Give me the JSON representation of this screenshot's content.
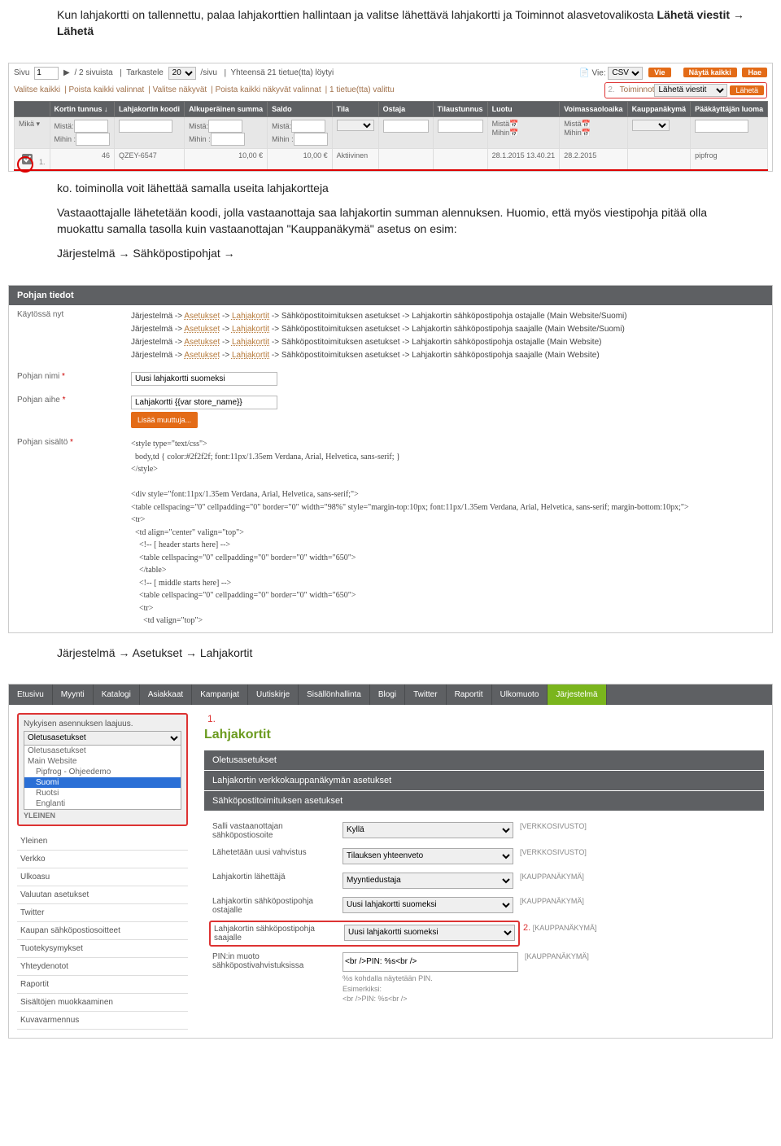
{
  "intro": {
    "p1a": "Kun lahjakortti on tallennettu, palaa lahjakorttien hallintaan ja valitse lähettävä lahjakortti ja Toiminnot alasvetovalikosta ",
    "p1b": "Lähetä viestit → Lähetä"
  },
  "shot1": {
    "page_lbl1": "Sivu",
    "page_val": "1",
    "page_lbl2": "/ 2 sivuista",
    "per_lbl1": "Tarkastele",
    "per_val": "20",
    "per_lbl2": "/sivu",
    "total": "Yhteensä 21 tietue(tta) löytyi",
    "vie_lbl": "Vie:",
    "vie_fmt": "CSV",
    "vie_btn": "Vie",
    "btn_show": "Näytä kaikki",
    "btn_search": "Hae",
    "sel_all": "Valitse kaikki",
    "sel_none": "Poista kaikki valinnat",
    "sel_vis": "Valitse näkyvät",
    "sel_unvis": "Poista kaikki näkyvät valinnat",
    "sel_cnt": "1 tietue(tta) valittu",
    "num2": "2.",
    "act_lbl": "Toiminnot",
    "act_val": "Lähetä viestit",
    "act_btn": "Lähetä",
    "th": [
      "",
      "Kortin tunnus ↓",
      "Lahjakortin koodi",
      "Alkuperäinen summa",
      "Saldo",
      "Tila",
      "Ostaja",
      "Tilaustunnus",
      "Luotu",
      "Voimassaoloaika",
      "Kauppanäkymä",
      "Pääkäyttäjän luoma"
    ],
    "fl_from": "Mistä:",
    "fl_to": "Mihin :",
    "fl_any": "Mikä ▾",
    "fl_from2": "Mistä",
    "fl_to2": "Mihin",
    "row": {
      "num1": "1.",
      "id": "46",
      "code": "QZEY-6547",
      "orig": "10,00 €",
      "sal": "10,00 €",
      "tila": "Aktiivinen",
      "luotu": "28.1.2015 13.40.21",
      "voim": "28.2.2015",
      "user": "pipfrog"
    }
  },
  "mid": {
    "p_ko": "ko. toiminolla voit lähettää samalla useita lahjakortteja",
    "p2": "Vastaaottajalle lähetetään koodi, jolla vastaanottaja saa lahjakortin summan alennuksen. Huomio, että myös viestipohja pitää olla muokattu samalla tasolla kuin vastaanottajan \"Kauppanäkymä\" asetus on esim:",
    "crumb": "Järjestelmä → Sähköpostipohjat →"
  },
  "shot2": {
    "bar": "Pohjan tiedot",
    "lbl_used": "Käytössä nyt",
    "used_line_pref": "Järjestelmä -> ",
    "used_link1": "Asetukset",
    "used_link2": "Lahjakortit",
    "used_tail": " -> Sähköpostitoimituksen asetukset -> ",
    "used": [
      "Lahjakortin sähköpostipohja ostajalle  (Main Website/Suomi)",
      "Lahjakortin sähköpostipohja saajalle  (Main Website/Suomi)",
      "Lahjakortin sähköpostipohja ostajalle  (Main Website)",
      "Lahjakortin sähköpostipohja saajalle  (Main Website)"
    ],
    "lbl_name": "Pohjan nimi",
    "val_name": "Uusi lahjakortti suomeksi",
    "lbl_subj": "Pohjan aihe",
    "val_subj": "Lahjakortti {{var store_name}}",
    "btn_vars": "Lisää muuttuja...",
    "lbl_body": "Pohjan sisältö",
    "code": "<style type=\"text/css\">\n  body,td { color:#2f2f2f; font:11px/1.35em Verdana, Arial, Helvetica, sans-serif; }\n</style>\n\n<div style=\"font:11px/1.35em Verdana, Arial, Helvetica, sans-serif;\">\n<table cellspacing=\"0\" cellpadding=\"0\" border=\"0\" width=\"98%\" style=\"margin-top:10px; font:11px/1.35em Verdana, Arial, Helvetica, sans-serif; margin-bottom:10px;\">\n<tr>\n  <td align=\"center\" valign=\"top\">\n    <!-- [ header starts here] -->\n    <table cellspacing=\"0\" cellpadding=\"0\" border=\"0\" width=\"650\">\n    </table>\n    <!-- [ middle starts here] -->\n    <table cellspacing=\"0\" cellpadding=\"0\" border=\"0\" width=\"650\">\n    <tr>\n      <td valign=\"top\">"
  },
  "crumb2": "Järjestelmä → Asetukset → Lahjakortit",
  "shot3": {
    "nav": [
      "Etusivu",
      "Myynti",
      "Katalogi",
      "Asiakkaat",
      "Kampanjat",
      "Uutiskirje",
      "Sisällönhallinta",
      "Blogi",
      "Twitter",
      "Raportit",
      "Ulkomuoto",
      "Järjestelmä"
    ],
    "num1": "1.",
    "scope_title": "Nykyisen asennuksen laajuus.",
    "scope_sel": "Oletusasetukset",
    "scope_opts": [
      "Oletusasetukset",
      "Main Website",
      "Pipfrog - Ohjeedemo",
      "Suomi",
      "Ruotsi",
      "Englanti"
    ],
    "yleinen": "YLEINEN",
    "side": [
      "Yleinen",
      "Verkko",
      "Ulkoasu",
      "Valuutan asetukset",
      "Twitter",
      "Kaupan sähköpostiosoitteet",
      "Tuotekysymykset",
      "Yhteydenotot",
      "Raportit",
      "Sisältöjen muokkaaminen",
      "Kuvavarmennus"
    ],
    "h": "Lahjakortit",
    "acc": [
      "Oletusasetukset",
      "Lahjakortin verkkokauppanäkymän asetukset",
      "Sähköpostitoimituksen asetukset"
    ],
    "rows": [
      {
        "l": "Salli vastaanottajan sähköpostiosoite",
        "v": "Kyllä",
        "s": "[VERKKOSIVUSTO]"
      },
      {
        "l": "Lähetetään uusi vahvistus",
        "v": "Tilauksen yhteenveto",
        "s": "[VERKKOSIVUSTO]"
      },
      {
        "l": "Lahjakortin lähettäjä",
        "v": "Myyntiedustaja",
        "s": "[KAUPPANÄKYMÄ]"
      },
      {
        "l": "Lahjakortin sähköpostipohja ostajalle",
        "v": "Uusi lahjakortti suomeksi",
        "s": "[KAUPPANÄKYMÄ]"
      },
      {
        "l": "Lahjakortin sähköpostipohja saajalle",
        "v": "Uusi lahjakortti suomeksi",
        "s": "[KAUPPANÄKYMÄ]",
        "hl": true,
        "n": "2."
      },
      {
        "l": "PIN:in muoto sähköpostivahvistuksissa",
        "v": "<br />PIN: %s<br />",
        "s": "[KAUPPANÄKYMÄ]",
        "txt": true,
        "help": "%s kohdalla näytetään PIN.\nEsimerkiksi:\n<br />PIN: %s<br />"
      }
    ]
  }
}
